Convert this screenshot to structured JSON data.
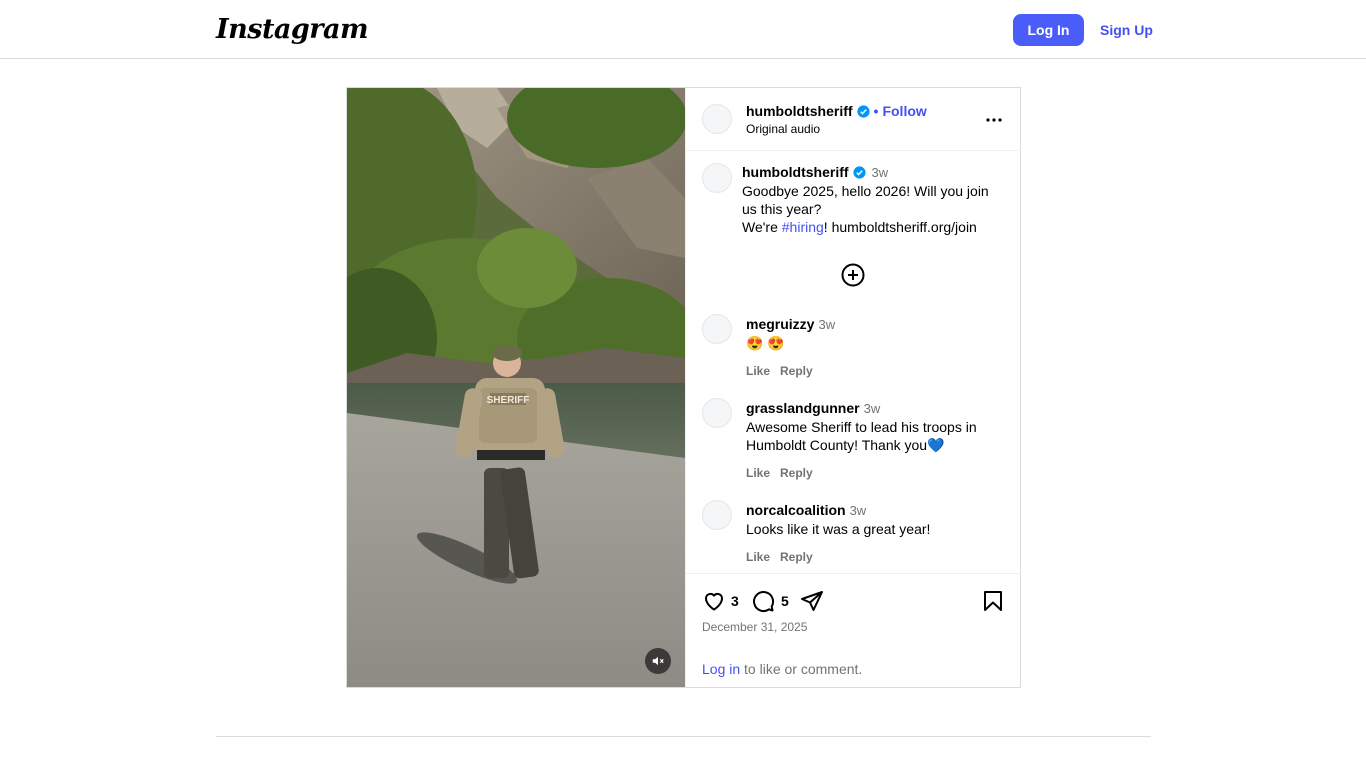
{
  "header": {
    "logo": "Instagram",
    "login_label": "Log In",
    "signup_label": "Sign Up"
  },
  "post": {
    "username": "humboldtsheriff",
    "follow_label": "Follow",
    "separator": "•",
    "audio": "Original audio",
    "caption": {
      "username": "humboldtsheriff",
      "time": "3w",
      "line1": "Goodbye 2025, hello 2026! Will you join us this year?",
      "line2_prefix": "We're ",
      "hashtag": "#hiring",
      "line2_suffix": "! humboldtsheriff.org/join"
    },
    "comments": [
      {
        "username": "megruizzy",
        "time": "3w",
        "text": "😍 😍",
        "like": "Like",
        "reply": "Reply"
      },
      {
        "username": "grasslandgunner",
        "time": "3w",
        "text": "Awesome Sheriff to lead his troops in Humboldt County! Thank you💙",
        "like": "Like",
        "reply": "Reply"
      },
      {
        "username": "norcalcoalition",
        "time": "3w",
        "text": "Looks like it was a great year!",
        "like": "Like",
        "reply": "Reply"
      }
    ],
    "likes_count": "3",
    "comments_count": "5",
    "date": "December 31, 2025",
    "login_prompt_link": "Log in",
    "login_prompt_rest": " to like or comment.",
    "media_patch_text": "SHERIFF"
  },
  "colors": {
    "accent": "#4a5df9",
    "link": "#4150f7",
    "verified": "#0095f6",
    "muted": "#737373",
    "border": "#dbdbdb"
  },
  "icons": {
    "like": "heart-icon",
    "comment": "comment-icon",
    "share": "share-icon",
    "save": "bookmark-icon",
    "more": "more-icon",
    "mute": "muted-speaker-icon",
    "load_more": "plus-circle-icon",
    "verified": "verified-badge-icon"
  }
}
